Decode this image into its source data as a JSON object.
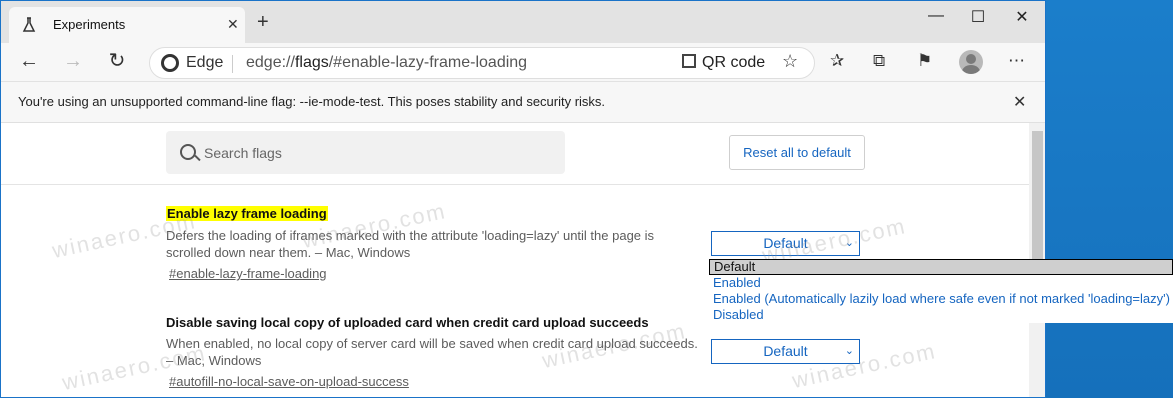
{
  "browser": {
    "tab_title": "Experiments",
    "tab_icon": "flask-icon",
    "window_controls": [
      "minimize",
      "maximize",
      "close"
    ]
  },
  "toolbar": {
    "edge_label": "Edge",
    "url_prefix": "edge://",
    "url_host": "flags",
    "url_rest": "/#enable-lazy-frame-loading",
    "qr_label": "QR code"
  },
  "infobar": {
    "message": "You're using an unsupported command-line flag: --ie-mode-test. This poses stability and security risks."
  },
  "page": {
    "search_placeholder": "Search flags",
    "reset_label": "Reset all to default",
    "flags": [
      {
        "title": "Enable lazy frame loading",
        "desc_line1": "Defers the loading of iframes marked with the attribute 'loading=lazy' until the page is",
        "desc_line2": "scrolled down near them. – Mac, Windows",
        "link": "#enable-lazy-frame-loading",
        "select_value": "Default"
      },
      {
        "title": "Disable saving local copy of uploaded card when credit card upload succeeds",
        "desc_line1": "When enabled, no local copy of server card will be saved when credit card upload succeeds.",
        "desc_line2": "– Mac, Windows",
        "link": "#autofill-no-local-save-on-upload-success",
        "select_value": "Default"
      }
    ],
    "dropdown_options": [
      "Default",
      "Enabled",
      "Enabled (Automatically lazily load where safe even if not marked 'loading=lazy')",
      "Disabled"
    ],
    "watermark": "winaero.com"
  }
}
